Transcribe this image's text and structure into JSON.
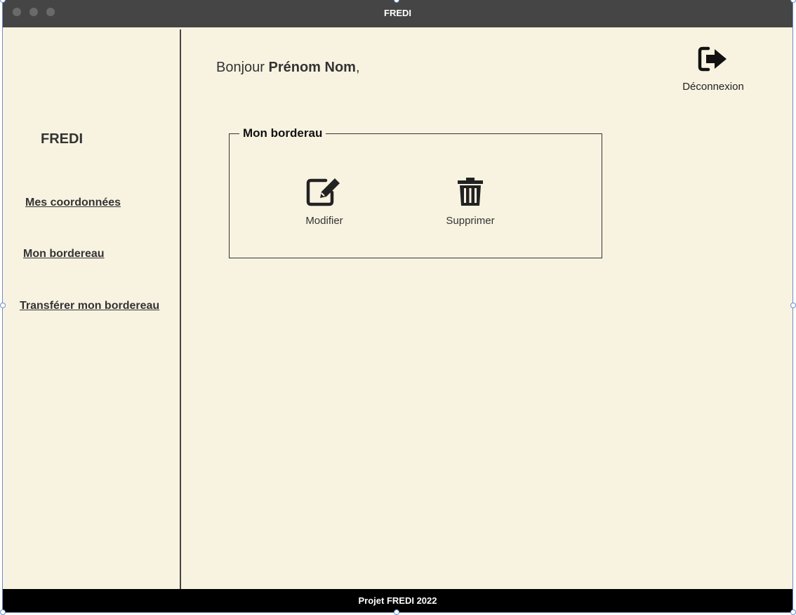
{
  "window": {
    "title": "FREDI"
  },
  "sidebar": {
    "brand": "FREDI",
    "items": [
      {
        "label": "Mes coordonnées"
      },
      {
        "label": "Mon bordereau"
      },
      {
        "label": "Transférer mon bordereau"
      }
    ]
  },
  "header": {
    "greeting_prefix": "Bonjour ",
    "user_name": "Prénom Nom",
    "greeting_suffix": ",",
    "logout_label": "Déconnexion",
    "logout_icon": "sign-out-icon"
  },
  "panel": {
    "legend": "Mon borderau",
    "actions": [
      {
        "label": "Modifier",
        "icon": "edit-icon"
      },
      {
        "label": "Supprimer",
        "icon": "trash-icon"
      }
    ]
  },
  "footer": {
    "text": "Projet FREDI 2022"
  }
}
